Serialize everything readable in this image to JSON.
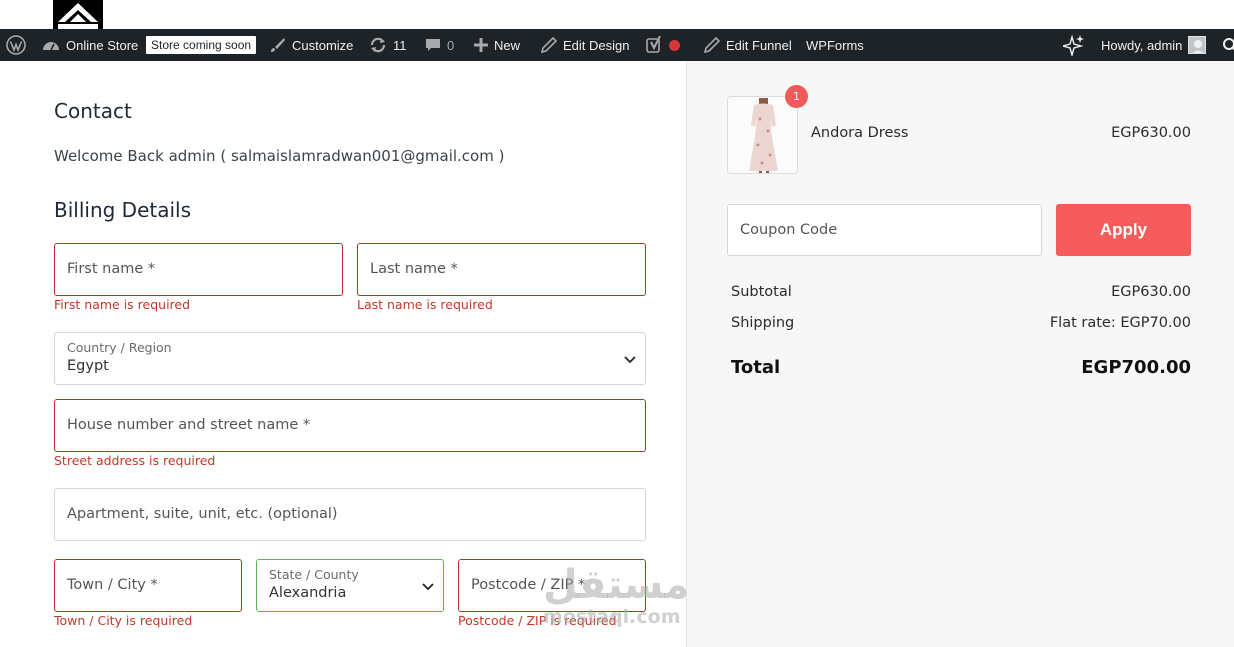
{
  "admin_bar": {
    "site_name": "Online Store",
    "coming_soon_badge": "Store coming soon",
    "customize": "Customize",
    "updates_count": "11",
    "comments_count": "0",
    "new": "New",
    "edit_design": "Edit Design",
    "edit_funnel": "Edit Funnel",
    "wpforms": "WPForms",
    "howdy": "Howdy, admin",
    "icons": [
      "wordpress-logo-icon",
      "dashboard-icon",
      "brush-icon",
      "refresh-icon",
      "comment-icon",
      "plus-icon",
      "pencil-icon",
      "yoast-icon",
      "pencil-icon",
      "sparkle-icon",
      "search-icon"
    ]
  },
  "contact": {
    "heading": "Contact",
    "welcome": "Welcome Back admin ( salmaislamradwan001@gmail.com )"
  },
  "billing": {
    "heading": "Billing Details",
    "first_name": {
      "placeholder": "First name *",
      "error": "First name is required"
    },
    "last_name": {
      "placeholder": "Last name *",
      "error": "Last name is required"
    },
    "country": {
      "label": "Country / Region",
      "value": "Egypt"
    },
    "street": {
      "placeholder": "House number and street name *",
      "error": "Street address is required"
    },
    "apartment": {
      "placeholder": "Apartment, suite, unit, etc. (optional)"
    },
    "city": {
      "placeholder": "Town / City *",
      "error": "Town / City is required"
    },
    "state": {
      "label": "State / County",
      "value": "Alexandria"
    },
    "postcode": {
      "placeholder": "Postcode / ZIP *",
      "error": "Postcode / ZIP is required"
    }
  },
  "order": {
    "item": {
      "name": "Andora Dress",
      "price": "EGP630.00",
      "quantity": "1"
    },
    "coupon": {
      "placeholder": "Coupon Code",
      "button": "Apply"
    },
    "subtotal_label": "Subtotal",
    "subtotal_value": "EGP630.00",
    "shipping_label": "Shipping",
    "shipping_value": "Flat rate: EGP70.00",
    "total_label": "Total",
    "total_value": "EGP700.00"
  },
  "watermark": {
    "arabic": "مستقل",
    "latin": "mostaql.com"
  },
  "colors": {
    "admin_bar": "#1d2327",
    "error": "#c0392b",
    "valid_border": "#5ab552",
    "accent_button": "#f65c5c",
    "sidebar_bg": "#f7f7f7"
  }
}
